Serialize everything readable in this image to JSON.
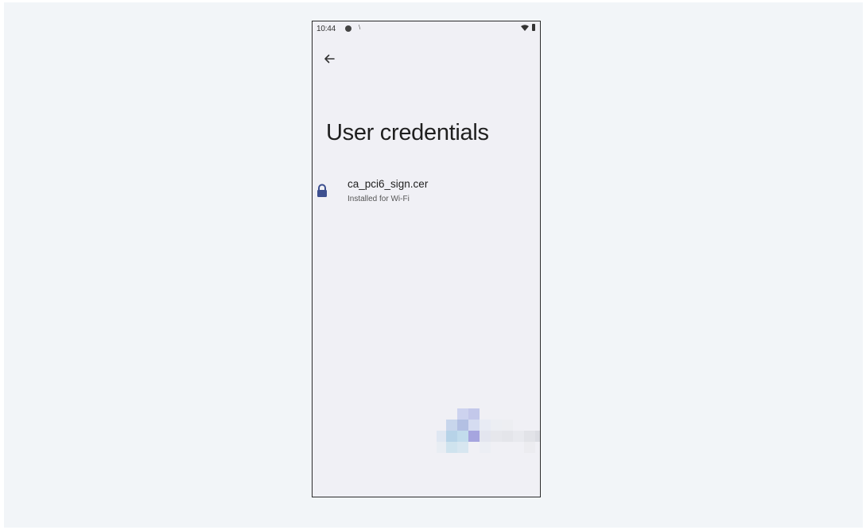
{
  "status_bar": {
    "time": "10:44",
    "extra_indicator": "N",
    "icons": [
      "notification-dot-icon",
      "wifi-icon",
      "battery-icon"
    ]
  },
  "nav": {
    "back_icon": "arrow-left-icon"
  },
  "page": {
    "title": "User credentials"
  },
  "credentials": [
    {
      "icon": "lock-icon",
      "name": "ca_pci6_sign.cer",
      "subtitle": "Installed for Wi-Fi"
    }
  ],
  "colors": {
    "backdrop": "#f2f5f8",
    "screen_background": "#f0f0f5",
    "lock_icon": "#3d4f8f",
    "title_text": "#1f1f1f"
  }
}
